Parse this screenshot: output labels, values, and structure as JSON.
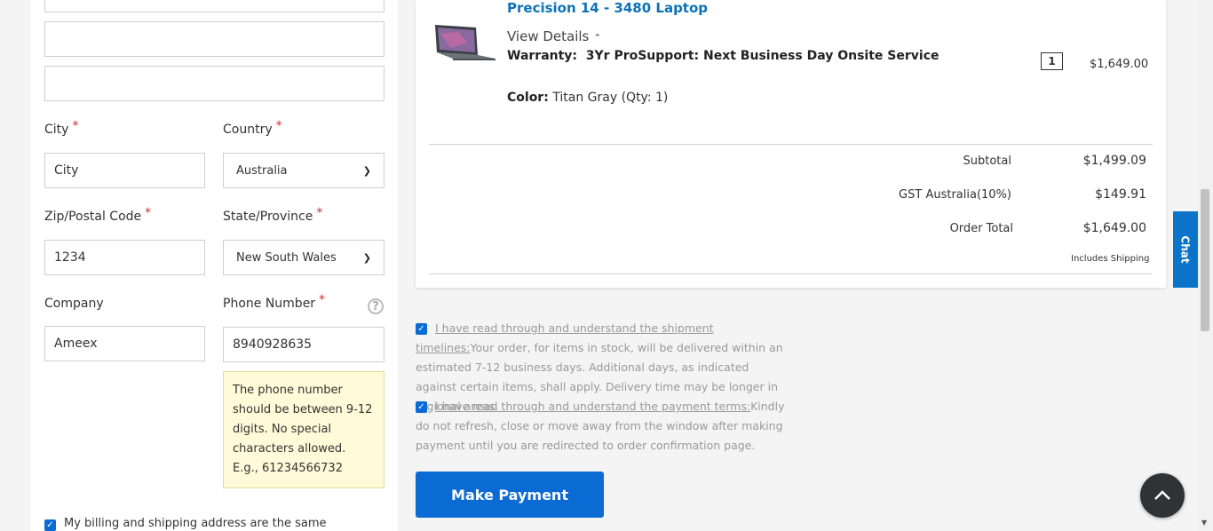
{
  "form": {
    "city_label": "City",
    "city_value": "City",
    "country_label": "Country",
    "country_value": "Australia",
    "zip_label": "Zip/Postal Code",
    "zip_value": "1234",
    "state_label": "State/Province",
    "state_value": "New South Wales",
    "company_label": "Company",
    "company_value": "Ameex",
    "phone_label": "Phone Number",
    "phone_value": "8940928635",
    "required_mark": "*",
    "help_icon_text": "?",
    "phone_tip": "The phone number should be between 9-12 digits. No special characters allowed. E.g., 61234566732",
    "same_address_label": "My billing and shipping address are the same"
  },
  "order": {
    "product_title": "Precision 14 - 3480 Laptop",
    "view_details": "View Details",
    "warranty_label": "Warranty:",
    "warranty_value": "3Yr ProSupport: Next Business Day Onsite Service",
    "color_label": "Color:",
    "color_value": "Titan Gray (Qty: 1)",
    "qty": "1",
    "price": "$1,649.00",
    "subtotal_label": "Subtotal",
    "subtotal_value": "$1,499.09",
    "gst_label": "GST Australia(10%)",
    "gst_value": "$149.91",
    "total_label": "Order Total",
    "total_value": "$1,649.00",
    "includes_shipping": "Includes Shipping"
  },
  "terms": {
    "shipment_link": "I have read through and understand the shipment timelines:",
    "shipment_text": "Your order, for items in stock, will be delivered within an estimated 7-12 business days. Additional days, as indicated against certain items, shall apply. Delivery time may be longer in regional areas.",
    "payment_link": "I have read through and understand the payment terms:",
    "payment_text": "Kindly do not refresh, close or move away from the window after making payment until you are redirected to order confirmation page."
  },
  "actions": {
    "make_payment": "Make Payment",
    "chat": "Chat"
  },
  "colors": {
    "accent": "#0b6bd4",
    "link_blue": "#0b72b8",
    "required_red": "#d42c2c",
    "tip_background": "#fffbd9"
  },
  "icons": [
    "chevron-up-icon",
    "chevron-down-icon",
    "help-icon",
    "checkbox-checked-icon",
    "back-to-top-icon",
    "laptop-image"
  ]
}
